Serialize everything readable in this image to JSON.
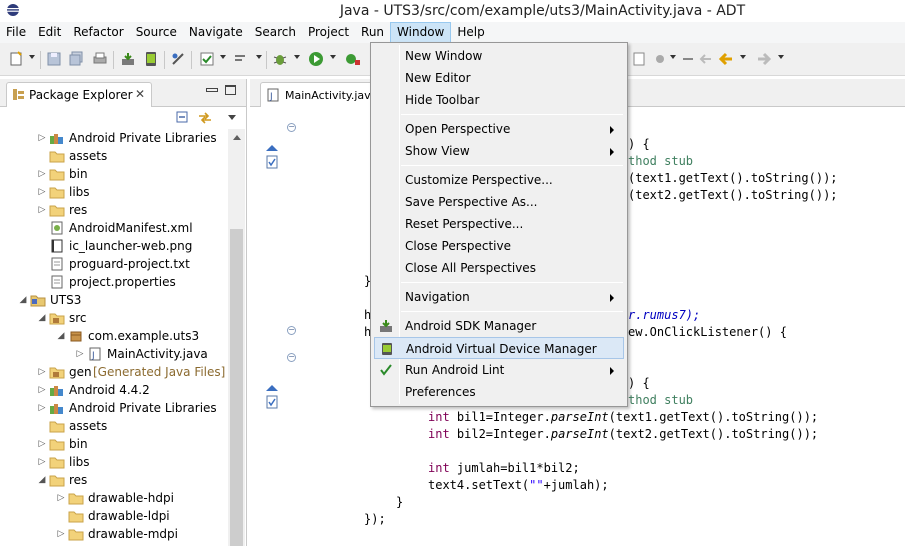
{
  "window": {
    "title": "Java - UTS3/src/com/example/uts3/MainActivity.java - ADT"
  },
  "menubar": {
    "items": [
      "File",
      "Edit",
      "Refactor",
      "Source",
      "Navigate",
      "Search",
      "Project",
      "Run",
      "Window",
      "Help"
    ],
    "active": "Window"
  },
  "explorer": {
    "tab_label": "Package Explorer",
    "tree": [
      {
        "label": "Android Private Libraries",
        "decoration": ""
      },
      {
        "label": "assets",
        "decoration": ""
      },
      {
        "label": "bin",
        "decoration": ""
      },
      {
        "label": "libs",
        "decoration": ""
      },
      {
        "label": "res",
        "decoration": ""
      },
      {
        "label": "AndroidManifest.xml",
        "decoration": ""
      },
      {
        "label": "ic_launcher-web.png",
        "decoration": ""
      },
      {
        "label": "proguard-project.txt",
        "decoration": ""
      },
      {
        "label": "project.properties",
        "decoration": ""
      },
      {
        "label": "UTS3",
        "decoration": ""
      },
      {
        "label": "src",
        "decoration": ""
      },
      {
        "label": "com.example.uts3",
        "decoration": ""
      },
      {
        "label": "MainActivity.java",
        "decoration": ""
      },
      {
        "label": "gen",
        "decoration": "[Generated Java Files]"
      },
      {
        "label": "Android 4.4.2",
        "decoration": ""
      },
      {
        "label": "Android Private Libraries",
        "decoration": ""
      },
      {
        "label": "assets",
        "decoration": ""
      },
      {
        "label": "bin",
        "decoration": ""
      },
      {
        "label": "libs",
        "decoration": ""
      },
      {
        "label": "res",
        "decoration": ""
      },
      {
        "label": "drawable-hdpi",
        "decoration": ""
      },
      {
        "label": "drawable-ldpi",
        "decoration": ""
      },
      {
        "label": "drawable-mdpi",
        "decoration": ""
      }
    ]
  },
  "editor": {
    "tab_label": "MainActivity.java",
    "code": {
      "l1": ") {",
      "l2": "thod stub",
      "l3a": "(text1.getText().toString());",
      "l4a": "(text2.getText().toString());",
      "l5": "}",
      "l6a": "h",
      "l6b": "r.rumus7);",
      "l7a": "h",
      "l7b": "ew.OnClickListener() {",
      "l8": ") {",
      "l9": "thod stub",
      "l10_kw": "int",
      "l10_rest": " bil1=Integer.",
      "l10_m": "parseInt",
      "l10_end": "(text1.getText().toString());",
      "l11_kw": "int",
      "l11_rest": " bil2=Integer.",
      "l11_m": "parseInt",
      "l11_end": "(text2.getText().toString());",
      "l12_kw": "int",
      "l12_rest": " jumlah=bil1*bil2;",
      "l13a": "text4.setText(",
      "l13b": "\"\"",
      "l13c": "+jumlah);",
      "l14": "}",
      "l15": "});"
    }
  },
  "window_menu": {
    "items": {
      "new_window": "New Window",
      "new_editor": "New Editor",
      "hide_toolbar": "Hide Toolbar",
      "open_perspective": "Open Perspective",
      "show_view": "Show View",
      "customize_perspective": "Customize Perspective...",
      "save_perspective_as": "Save Perspective As...",
      "reset_perspective": "Reset Perspective...",
      "close_perspective": "Close Perspective",
      "close_all_perspectives": "Close All Perspectives",
      "navigation": "Navigation",
      "android_sdk_manager": "Android SDK Manager",
      "android_avd_manager": "Android Virtual Device Manager",
      "run_android_lint": "Run Android Lint",
      "preferences": "Preferences"
    },
    "highlighted": "Android Virtual Device Manager"
  }
}
